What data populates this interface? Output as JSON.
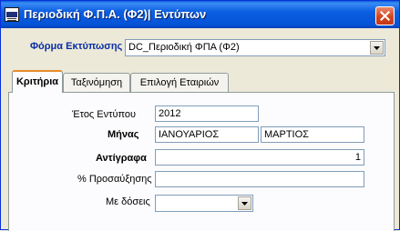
{
  "window": {
    "title": "Περιοδική Φ.Π.Α. (Φ2)| Εντύπων"
  },
  "print_form": {
    "label": "Φόρμα Εκτύπωσης",
    "value": "DC_Περιοδική ΦΠΑ (Φ2)"
  },
  "tabs": [
    {
      "label": "Κριτήρια",
      "active": true
    },
    {
      "label": "Ταξινόμηση",
      "active": false
    },
    {
      "label": "Επιλογή Εταιριών",
      "active": false
    }
  ],
  "criteria": {
    "year_label": "Έτος Εντύπου",
    "year_value": "2012",
    "month_label": "Μήνας",
    "month_from": "ΙΑΝΟΥΑΡΙΟΣ",
    "month_to": "ΜΑΡΤΙΟΣ",
    "copies_label": "Αντίγραφα",
    "copies_value": "1",
    "surcharge_label": "% Προσαύξησης",
    "surcharge_value": "",
    "installments_label": "Με δόσεις",
    "installments_value": ""
  }
}
